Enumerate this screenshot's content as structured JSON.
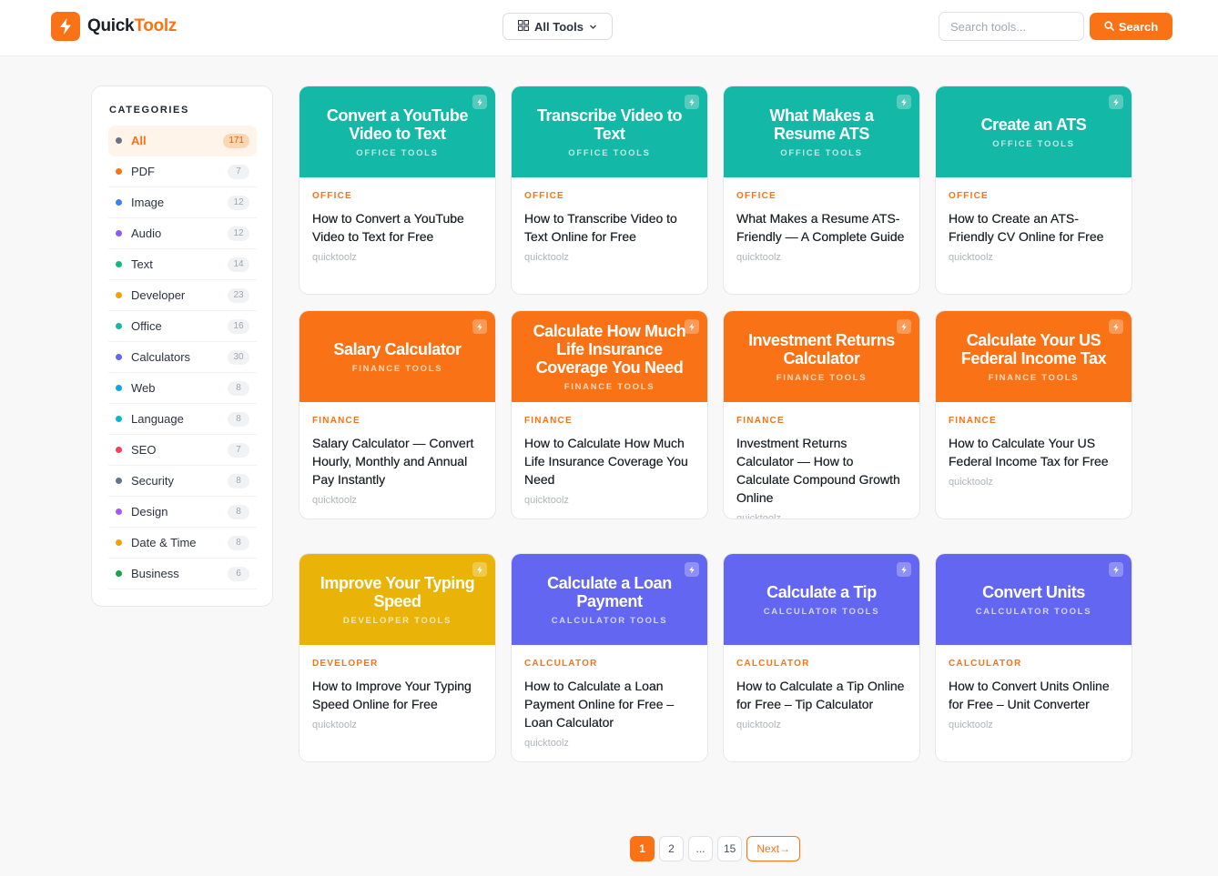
{
  "brand": {
    "name_part1": "Quick",
    "name_part2": "Toolz",
    "accent": "#f97316"
  },
  "header": {
    "all_tools_label": "All Tools",
    "search_placeholder": "Search tools...",
    "search_button": "Search"
  },
  "sidebar": {
    "title": "CATEGORIES",
    "items": [
      {
        "label": "All",
        "count": "171",
        "color": "#6b7280"
      },
      {
        "label": "PDF",
        "count": "7",
        "color": "#f97316"
      },
      {
        "label": "Image",
        "count": "12",
        "color": "#3b82f6"
      },
      {
        "label": "Audio",
        "count": "12",
        "color": "#8b5cf6"
      },
      {
        "label": "Text",
        "count": "14",
        "color": "#10b981"
      },
      {
        "label": "Developer",
        "count": "23",
        "color": "#f59e0b"
      },
      {
        "label": "Office",
        "count": "16",
        "color": "#14b8a6"
      },
      {
        "label": "Calculators",
        "count": "30",
        "color": "#6366f1"
      },
      {
        "label": "Web",
        "count": "8",
        "color": "#0ea5e9"
      },
      {
        "label": "Language",
        "count": "8",
        "color": "#06b6d4"
      },
      {
        "label": "SEO",
        "count": "7",
        "color": "#f43f5e"
      },
      {
        "label": "Security",
        "count": "8",
        "color": "#64748b"
      },
      {
        "label": "Design",
        "count": "8",
        "color": "#a855f7"
      },
      {
        "label": "Date & Time",
        "count": "8",
        "color": "#f59e0b"
      },
      {
        "label": "Business",
        "count": "6",
        "color": "#16a34a"
      }
    ]
  },
  "cards": [
    {
      "banner_title": "Convert a YouTube Video to Text",
      "banner_sub": "OFFICE TOOLS",
      "tag": "OFFICE",
      "title": "How to Convert a YouTube Video to Text for Free",
      "author": "quicktoolz",
      "color": "teal"
    },
    {
      "banner_title": "Transcribe Video to Text",
      "banner_sub": "OFFICE TOOLS",
      "tag": "OFFICE",
      "title": "How to Transcribe Video to Text Online for Free",
      "author": "quicktoolz",
      "color": "teal"
    },
    {
      "banner_title": "What Makes a Resume ATS",
      "banner_sub": "OFFICE TOOLS",
      "tag": "OFFICE",
      "title": "What Makes a Resume ATS-Friendly — A Complete Guide",
      "author": "quicktoolz",
      "color": "teal"
    },
    {
      "banner_title": "Create an ATS",
      "banner_sub": "OFFICE TOOLS",
      "tag": "OFFICE",
      "title": "How to Create an ATS-Friendly CV Online for Free",
      "author": "quicktoolz",
      "color": "teal"
    },
    {
      "banner_title": "Salary Calculator",
      "banner_sub": "FINANCE TOOLS",
      "tag": "FINANCE",
      "title": "Salary Calculator — Convert Hourly, Monthly and Annual Pay Instantly",
      "author": "quicktoolz",
      "color": "orange"
    },
    {
      "banner_title": "Calculate How Much Life Insurance Coverage You Need",
      "banner_sub": "FINANCE TOOLS",
      "tag": "FINANCE",
      "title": "How to Calculate How Much Life Insurance Coverage You Need",
      "author": "quicktoolz",
      "color": "orange"
    },
    {
      "banner_title": "Investment Returns Calculator",
      "banner_sub": "FINANCE TOOLS",
      "tag": "FINANCE",
      "title": "Investment Returns Calculator — How to Calculate Compound Growth Online",
      "author": "quicktoolz",
      "color": "orange"
    },
    {
      "banner_title": "Calculate Your US Federal Income Tax",
      "banner_sub": "FINANCE TOOLS",
      "tag": "FINANCE",
      "title": "How to Calculate Your US Federal Income Tax for Free",
      "author": "quicktoolz",
      "color": "orange"
    },
    {
      "banner_title": "Improve Your Typing Speed",
      "banner_sub": "DEVELOPER TOOLS",
      "tag": "DEVELOPER",
      "title": "How to Improve Your Typing Speed Online for Free",
      "author": "quicktoolz",
      "color": "yellow"
    },
    {
      "banner_title": "Calculate a Loan Payment",
      "banner_sub": "CALCULATOR TOOLS",
      "tag": "CALCULATOR",
      "title": "How to Calculate a Loan Payment Online for Free – Loan Calculator",
      "author": "quicktoolz",
      "color": "indigo"
    },
    {
      "banner_title": "Calculate a Tip",
      "banner_sub": "CALCULATOR TOOLS",
      "tag": "CALCULATOR",
      "title": "How to Calculate a Tip Online for Free – Tip Calculator",
      "author": "quicktoolz",
      "color": "indigo"
    },
    {
      "banner_title": "Convert Units",
      "banner_sub": "CALCULATOR TOOLS",
      "tag": "CALCULATOR",
      "title": "How to Convert Units Online for Free – Unit Converter",
      "author": "quicktoolz",
      "color": "indigo"
    }
  ],
  "pagination": {
    "pages": [
      "1",
      "2",
      "...",
      "15"
    ],
    "next_label": "Next→"
  }
}
